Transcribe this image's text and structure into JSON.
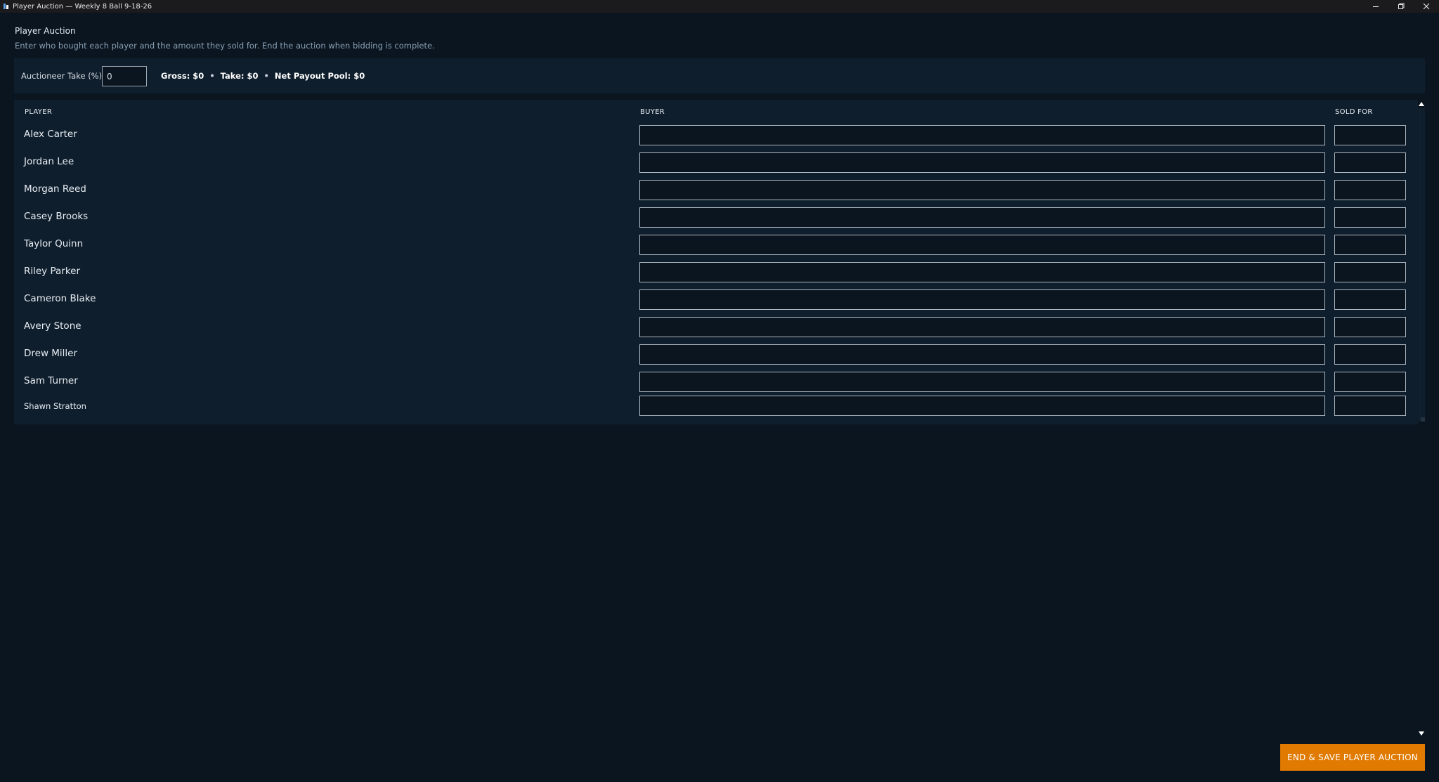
{
  "window": {
    "title": "Player Auction — Weekly 8 Ball 9-18-26",
    "icon": "app-icon",
    "controls": [
      "minimize-icon",
      "restore-icon",
      "close-icon"
    ]
  },
  "header": {
    "title": "Player Auction",
    "subtitle": "Enter who bought each player and the amount they sold for. End the auction when bidding is complete."
  },
  "take_bar": {
    "label": "Auctioneer Take (%)",
    "value": "0",
    "gross": "Gross: $0",
    "take": "Take: $0",
    "net": "Net Payout Pool: $0",
    "separator": "•"
  },
  "table": {
    "headers": {
      "player": "PLAYER",
      "buyer": "BUYER",
      "sold_for": "SOLD FOR"
    },
    "rows": [
      {
        "player": "Alex Carter",
        "buyer": "",
        "sold_for": ""
      },
      {
        "player": "Jordan Lee",
        "buyer": "",
        "sold_for": ""
      },
      {
        "player": "Morgan Reed",
        "buyer": "",
        "sold_for": ""
      },
      {
        "player": "Casey Brooks",
        "buyer": "",
        "sold_for": ""
      },
      {
        "player": "Taylor Quinn",
        "buyer": "",
        "sold_for": ""
      },
      {
        "player": "Riley Parker",
        "buyer": "",
        "sold_for": ""
      },
      {
        "player": "Cameron Blake",
        "buyer": "",
        "sold_for": ""
      },
      {
        "player": "Avery Stone",
        "buyer": "",
        "sold_for": ""
      },
      {
        "player": "Drew Miller",
        "buyer": "",
        "sold_for": ""
      },
      {
        "player": "Sam Turner",
        "buyer": "",
        "sold_for": ""
      },
      {
        "player": "Shawn Stratton",
        "buyer": "",
        "sold_for": ""
      }
    ]
  },
  "footer": {
    "end_button": "END & SAVE PLAYER AUCTION"
  },
  "colors": {
    "background": "#0a1520",
    "panel": "#0f1e2c",
    "accent": "#e07a00",
    "titlebar": "#1b1b1d"
  }
}
